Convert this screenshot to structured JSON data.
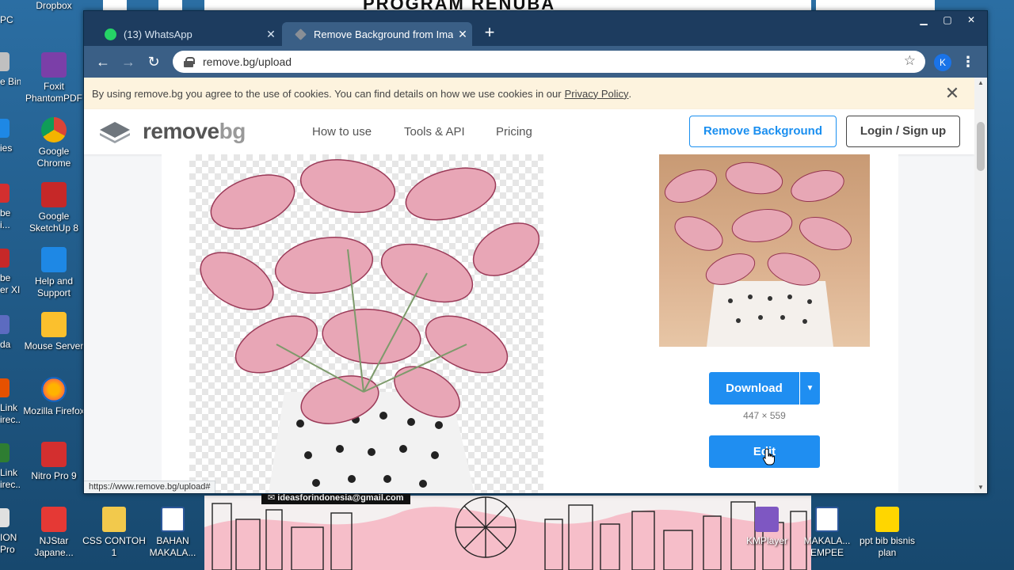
{
  "desktop": {
    "wallpaper_banner": "PROGRAM RENUBA",
    "left_icons": [
      {
        "label": "Dropbox",
        "icon": "dropbox-icon",
        "color": "#0061fe"
      },
      {
        "label": "Foxit PhantomPDF",
        "icon": "foxit-pdf-icon",
        "color": "#7b3fa8"
      },
      {
        "label": "Google Chrome",
        "icon": "chrome-icon",
        "color": "#db4437"
      },
      {
        "label": "Google SketchUp 8",
        "icon": "sketchup-icon",
        "color": "#c62828"
      },
      {
        "label": "Help and Support",
        "icon": "help-support-icon",
        "color": "#1e88e5"
      },
      {
        "label": "Mouse Server",
        "icon": "mouse-server-icon",
        "color": "#fbc02d"
      },
      {
        "label": "Mozilla Firefox",
        "icon": "firefox-icon",
        "color": "#ff7139"
      },
      {
        "label": "Nitro Pro 9",
        "icon": "nitro-pro-icon",
        "color": "#d32f2f"
      },
      {
        "label": "NJStar Japane...",
        "icon": "njstar-icon",
        "color": "#e53935"
      }
    ],
    "partial_labels": [
      "PC",
      "e Bin",
      "ies",
      "be\ni...",
      "be\ner XI",
      "da",
      "Link\nirec...",
      "Link\nirec...",
      "ION\nPro"
    ],
    "bottom_icons": [
      {
        "label": "CSS CONTOH 1",
        "icon": "folder-icon",
        "color": "#f2c94c"
      },
      {
        "label": "BAHAN MAKALA...",
        "icon": "word-doc-icon",
        "color": "#2b579a"
      },
      {
        "label": "KMPlayer",
        "icon": "kmplayer-icon",
        "color": "#7e57c2"
      },
      {
        "label": "MAKALA... EMPEE",
        "icon": "word-doc-icon",
        "color": "#2b579a"
      },
      {
        "label": "ppt bib bisnis plan",
        "icon": "ppt-icon",
        "color": "#ffd600"
      }
    ],
    "email_tag": "ideasforindonesia@gmail.com"
  },
  "browser": {
    "tabs": [
      {
        "title": "(13) WhatsApp",
        "icon": "whatsapp-icon",
        "active": false
      },
      {
        "title": "Remove Background from Image",
        "icon": "removebg-icon",
        "active": true
      }
    ],
    "new_tab": "+",
    "url": "remove.bg/upload",
    "profile_initial": "K",
    "status_url": "https://www.remove.bg/upload#"
  },
  "page": {
    "cookie": {
      "text": "By using remove.bg you agree to the use of cookies. You can find details on how we use cookies in our",
      "link": "Privacy Policy",
      "suffix": "."
    },
    "logo": {
      "part1": "remove",
      "part2": "bg"
    },
    "nav": [
      "How to use",
      "Tools & API",
      "Pricing"
    ],
    "remove_background_button": "Remove Background",
    "login_button": "Login / Sign up",
    "download_button": "Download",
    "image_dimensions": "447 × 559",
    "edit_button": "Edit"
  },
  "colors": {
    "accent": "#1f8ef1",
    "tab_bar": "#1d3c5f",
    "toolbar": "#3a5f86",
    "cookie_bg": "#fdf3de"
  }
}
